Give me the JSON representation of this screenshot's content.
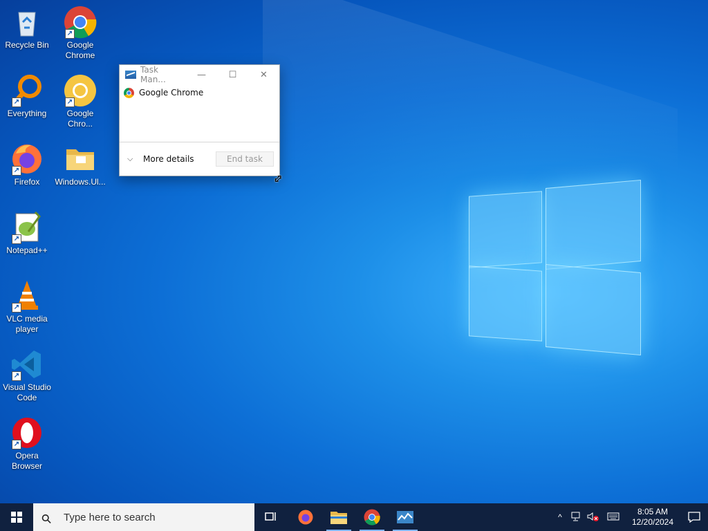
{
  "desktop": {
    "icons": [
      {
        "label": "Recycle Bin",
        "icon": "recycle-bin-icon"
      },
      {
        "label": "Google Chrome",
        "icon": "chrome-icon"
      },
      {
        "label": "Everything",
        "icon": "everything-search-icon"
      },
      {
        "label": "Google Chro...",
        "icon": "chrome-canary-icon"
      },
      {
        "label": "Firefox",
        "icon": "firefox-icon"
      },
      {
        "label": "Windows.Ul...",
        "icon": "folder-icon"
      },
      {
        "label": "Notepad++",
        "icon": "notepadpp-icon"
      },
      {
        "label": "VLC media player",
        "icon": "vlc-icon"
      },
      {
        "label": "Visual Studio Code",
        "icon": "vscode-icon"
      },
      {
        "label": "Opera Browser",
        "icon": "opera-icon"
      }
    ],
    "shortcut_arrow": "↗"
  },
  "task_manager": {
    "title": "Task Man...",
    "minimize": "—",
    "maximize": "☐",
    "close": "✕",
    "apps": [
      {
        "name": "Google Chrome",
        "icon": "chrome-icon"
      }
    ],
    "more_details": "More details",
    "end_task": "End task",
    "chevron": "⌵"
  },
  "taskbar": {
    "search_placeholder": "Type here to search",
    "search_glyph": "⚲",
    "pinned": [
      "task-view-icon",
      "firefox-icon",
      "file-explorer-icon",
      "chrome-icon",
      "task-manager-icon"
    ],
    "tray": {
      "chevron": "^",
      "time": "8:05 AM",
      "date": "12/20/2024"
    }
  },
  "colors": {
    "taskbar": "#10213f",
    "desktop_accent": "#0d6fd6"
  }
}
